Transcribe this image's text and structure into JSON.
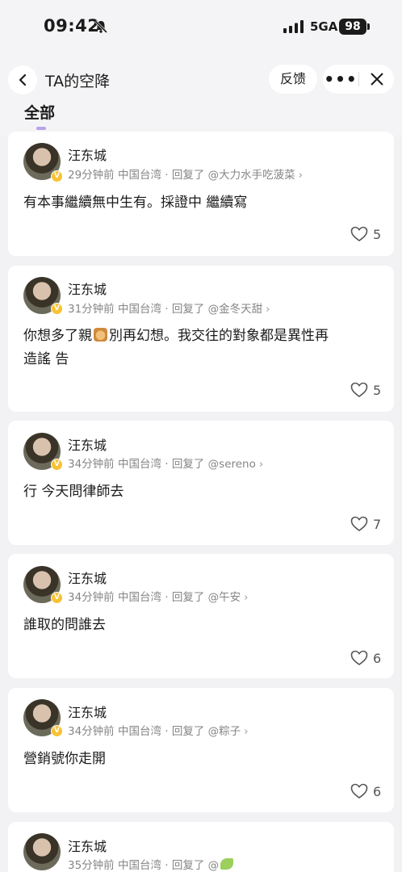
{
  "status_bar": {
    "time": "09:42",
    "network": "5GA",
    "battery": "98"
  },
  "header": {
    "title": "TA的空降",
    "feedback_label": "反馈",
    "tab_all": "全部"
  },
  "comments": [
    {
      "user": "汪东城",
      "time": "29分钟前",
      "location": "中国台湾",
      "reply_prefix": "回复了",
      "reply_to": "@大力水手吃菠菜",
      "text": "有本事繼續無中生有。採證中 繼續寫",
      "likes": "5"
    },
    {
      "user": "汪东城",
      "time": "31分钟前",
      "location": "中国台湾",
      "reply_prefix": "回复了",
      "reply_to": "@金冬天甜",
      "text_before": "你想多了親",
      "text_after": "別再幻想。我交往的對象都是異性再",
      "text_line2": "造謠 告",
      "likes": "5"
    },
    {
      "user": "汪东城",
      "time": "34分钟前",
      "location": "中国台湾",
      "reply_prefix": "回复了",
      "reply_to": "@sereno",
      "text": "行 今天問律師去",
      "likes": "7"
    },
    {
      "user": "汪东城",
      "time": "34分钟前",
      "location": "中国台湾",
      "reply_prefix": "回复了",
      "reply_to": "@午安",
      "text": "誰取的問誰去",
      "likes": "6"
    },
    {
      "user": "汪东城",
      "time": "34分钟前",
      "location": "中国台湾",
      "reply_prefix": "回复了",
      "reply_to": "@粽子",
      "text": "營銷號你走開",
      "likes": "6"
    },
    {
      "user": "汪东城",
      "time": "35分钟前",
      "location": "中国台湾",
      "reply_prefix": "回复了",
      "reply_to": "@"
    }
  ]
}
